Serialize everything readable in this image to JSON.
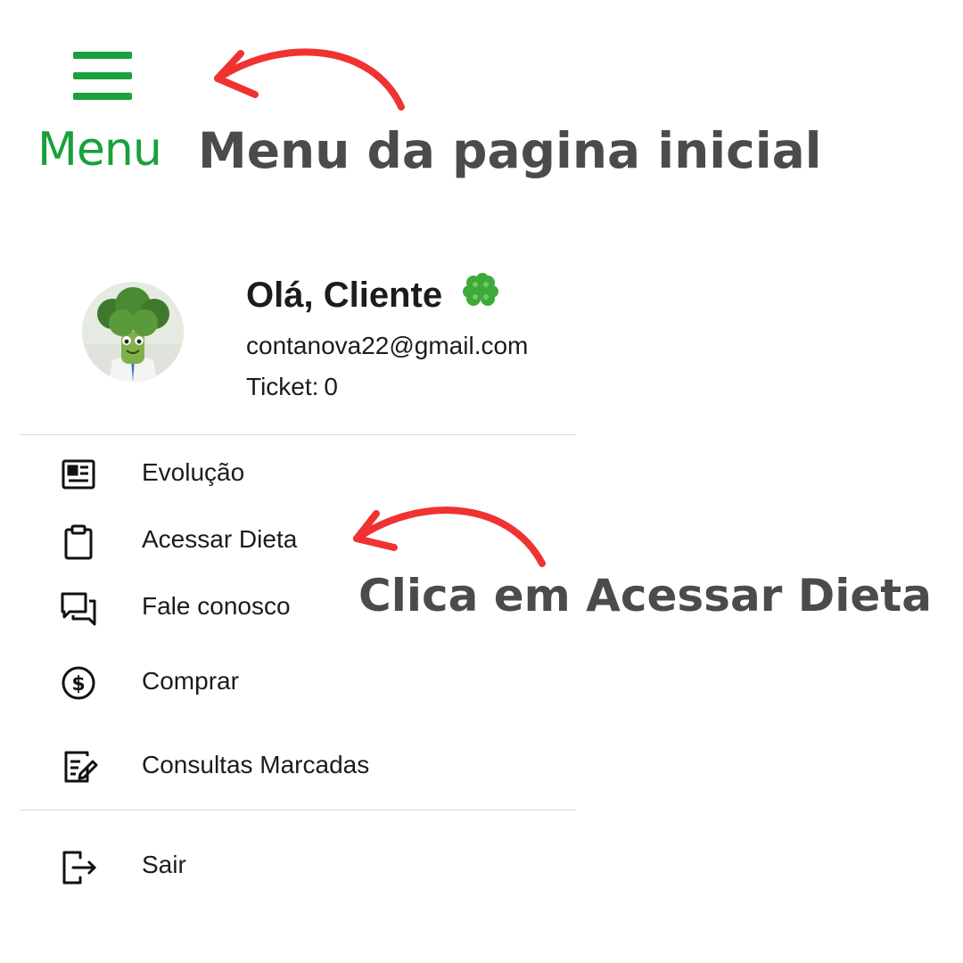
{
  "header": {
    "menu_label": "Menu",
    "menu_icon": "hamburger-icon",
    "brand_color": "#1aa03c"
  },
  "annotations": {
    "menu_note": "Menu da pagina inicial",
    "diet_note": "Clica em Acessar Dieta",
    "arrow_color": "#f03232",
    "text_color": "#4b4b4b"
  },
  "profile": {
    "greeting": "Olá, Cliente",
    "greeting_icon": "four-leaf-clover-icon",
    "avatar": "broccoli-doctor-avatar",
    "email": "contanova22@gmail.com",
    "ticket_label": "Ticket:",
    "ticket_value": "0"
  },
  "menu": {
    "items": [
      {
        "label": "Evolução",
        "icon": "newspaper-icon"
      },
      {
        "label": "Acessar Dieta",
        "icon": "clipboard-icon"
      },
      {
        "label": "Fale conosco",
        "icon": "chat-icon"
      },
      {
        "label": "Comprar",
        "icon": "dollar-circle-icon"
      },
      {
        "label": "Consultas Marcadas",
        "icon": "edit-note-icon"
      }
    ],
    "logout": {
      "label": "Sair",
      "icon": "logout-icon"
    }
  }
}
